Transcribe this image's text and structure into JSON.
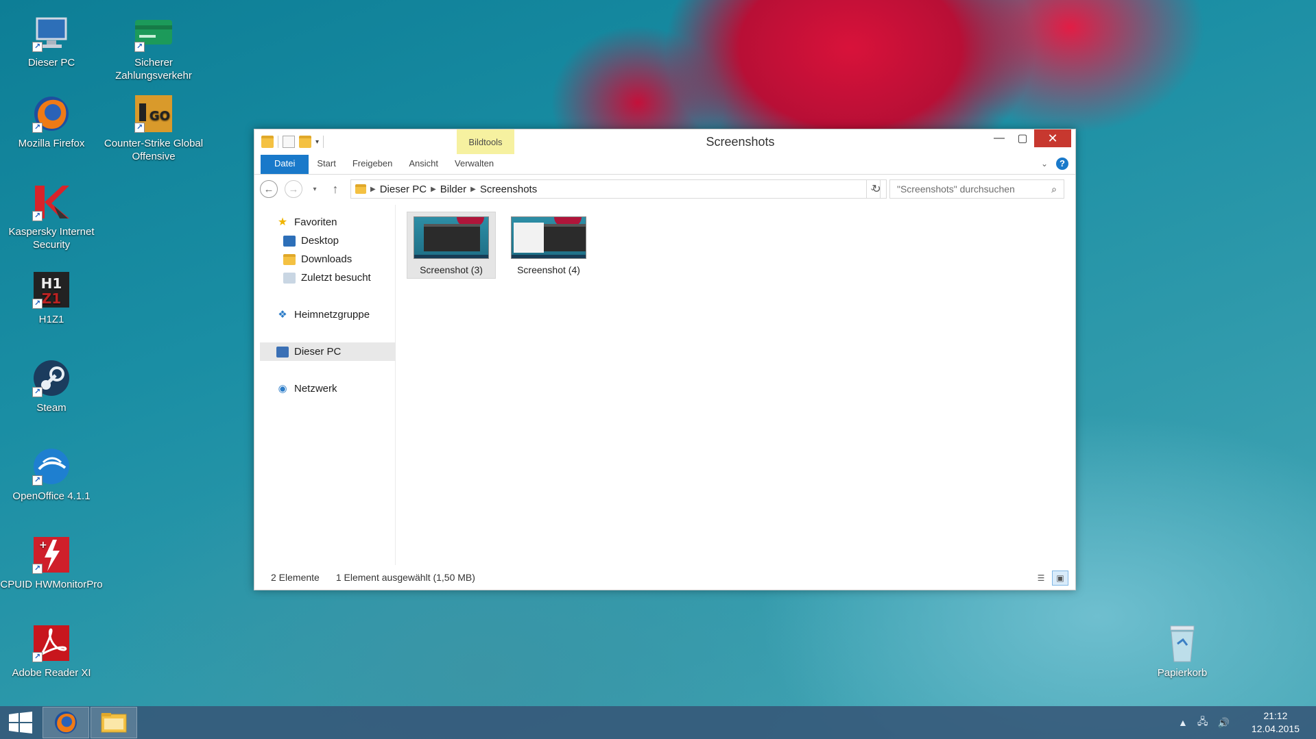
{
  "desktop": {
    "icons": [
      {
        "label": "Dieser PC"
      },
      {
        "label": "Sicherer Zahlungsverkehr"
      },
      {
        "label": "Mozilla Firefox"
      },
      {
        "label": "Counter-Strike Global Offensive"
      },
      {
        "label": "Kaspersky Internet Security"
      },
      {
        "label": "H1Z1"
      },
      {
        "label": "Steam"
      },
      {
        "label": "OpenOffice 4.1.1"
      },
      {
        "label": "CPUID HWMonitorPro"
      },
      {
        "label": "Adobe Reader XI"
      },
      {
        "label": "Papierkorb"
      }
    ]
  },
  "window": {
    "title": "Screenshots",
    "contextual_tab": "Bildtools",
    "ribbon_tabs": [
      "Datei",
      "Start",
      "Freigeben",
      "Ansicht",
      "Verwalten"
    ],
    "breadcrumb": [
      "Dieser PC",
      "Bilder",
      "Screenshots"
    ],
    "search_placeholder": "\"Screenshots\" durchsuchen",
    "nav": {
      "favorites": "Favoriten",
      "desktop": "Desktop",
      "downloads": "Downloads",
      "recent": "Zuletzt besucht",
      "homegroup": "Heimnetzgruppe",
      "this_pc": "Dieser PC",
      "network": "Netzwerk"
    },
    "files": [
      {
        "name": "Screenshot (3)",
        "selected": true
      },
      {
        "name": "Screenshot (4)",
        "selected": false
      }
    ],
    "status": {
      "count": "2 Elemente",
      "selection": "1 Element ausgewählt (1,50 MB)"
    }
  },
  "taskbar": {
    "time": "21:12",
    "date": "12.04.2015"
  },
  "colors": {
    "accent": "#1979ca",
    "close": "#c7382f",
    "contextual": "#f6f1a0"
  }
}
